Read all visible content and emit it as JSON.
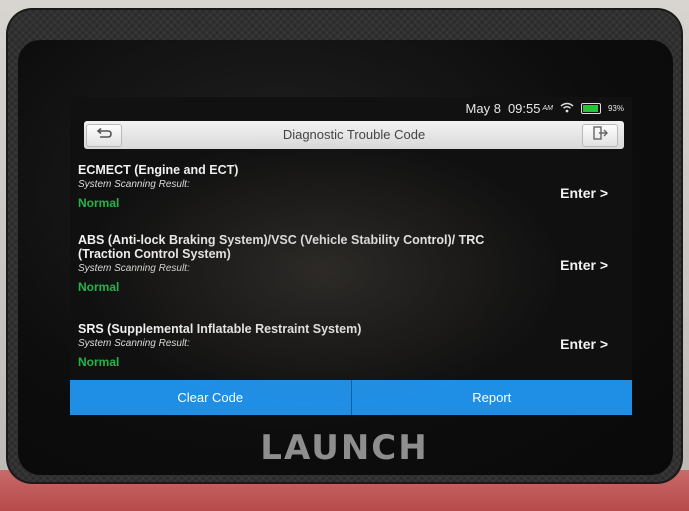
{
  "status_bar": {
    "date": "May 8",
    "time": "09:55",
    "ampm": "AM",
    "battery": "93%",
    "battery_level": 0.93
  },
  "header": {
    "title": "Diagnostic Trouble Code",
    "back_icon": "back-arrow-icon",
    "exit_icon": "exit-door-icon"
  },
  "systems": [
    {
      "name": "ECMECT (Engine and ECT)",
      "label": "System Scanning Result:",
      "status": "Normal",
      "enter": "Enter >"
    },
    {
      "name": "ABS (Anti-lock Braking System)/VSC (Vehicle Stability Control)/ TRC (Traction Control System)",
      "label": "System Scanning Result:",
      "status": "Normal",
      "enter": "Enter >"
    },
    {
      "name": "SRS (Supplemental Inflatable Restraint System)",
      "label": "System Scanning Result:",
      "status": "Normal",
      "enter": "Enter >"
    }
  ],
  "actions": {
    "clear_code": "Clear Code",
    "report": "Report"
  },
  "device": {
    "brand": "LAUNCH"
  },
  "colors": {
    "accent_blue": "#1f8fe6",
    "status_green": "#22b54a",
    "screen_bg": "#101010"
  }
}
